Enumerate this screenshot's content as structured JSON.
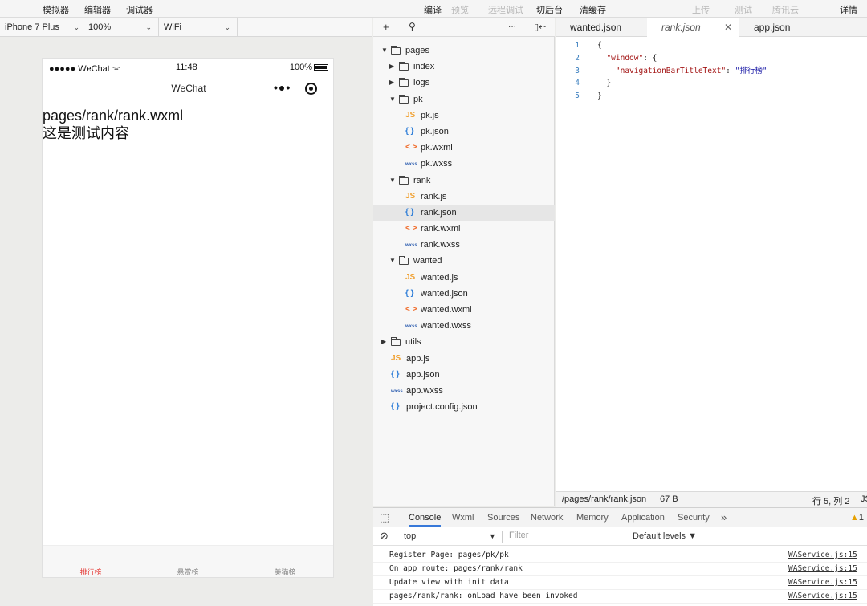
{
  "toolbar": {
    "simulator": "模拟器",
    "editor": "编辑器",
    "debugger": "调试器",
    "compile": "编译",
    "preview": "预览",
    "remote_debug": "远程调试",
    "background": "切后台",
    "clear_cache": "清缓存",
    "upload": "上传",
    "test": "测试",
    "tencent_cloud": "腾讯云",
    "details": "详情"
  },
  "sim": {
    "device": "iPhone 7 Plus",
    "zoom": "100%",
    "network": "WiFi"
  },
  "phone": {
    "carrier": "●●●●● WeChat",
    "time": "11:48",
    "battery": "100%",
    "nav_title": "WeChat",
    "content_line1": "pages/rank/rank.wxml",
    "content_line2": "这是测试内容",
    "tabs": [
      "排行榜",
      "悬赏榜",
      "美猫榜"
    ]
  },
  "tree": {
    "items": [
      {
        "label": "pages",
        "icon": "folder",
        "level": 0,
        "expanded": true
      },
      {
        "label": "index",
        "icon": "folder",
        "level": 1,
        "expanded": false
      },
      {
        "label": "logs",
        "icon": "folder",
        "level": 1,
        "expanded": false
      },
      {
        "label": "pk",
        "icon": "folder",
        "level": 1,
        "expanded": true
      },
      {
        "label": "pk.js",
        "icon": "js",
        "level": 2
      },
      {
        "label": "pk.json",
        "icon": "json",
        "level": 2
      },
      {
        "label": "pk.wxml",
        "icon": "wxml",
        "level": 2
      },
      {
        "label": "pk.wxss",
        "icon": "wxss",
        "level": 2
      },
      {
        "label": "rank",
        "icon": "folder",
        "level": 1,
        "expanded": true
      },
      {
        "label": "rank.js",
        "icon": "js",
        "level": 2
      },
      {
        "label": "rank.json",
        "icon": "json",
        "level": 2,
        "selected": true
      },
      {
        "label": "rank.wxml",
        "icon": "wxml",
        "level": 2
      },
      {
        "label": "rank.wxss",
        "icon": "wxss",
        "level": 2
      },
      {
        "label": "wanted",
        "icon": "folder",
        "level": 1,
        "expanded": true
      },
      {
        "label": "wanted.js",
        "icon": "js",
        "level": 2
      },
      {
        "label": "wanted.json",
        "icon": "json",
        "level": 2
      },
      {
        "label": "wanted.wxml",
        "icon": "wxml",
        "level": 2
      },
      {
        "label": "wanted.wxss",
        "icon": "wxss",
        "level": 2
      },
      {
        "label": "utils",
        "icon": "folder",
        "level": 0,
        "expanded": false
      },
      {
        "label": "app.js",
        "icon": "js",
        "level": 0
      },
      {
        "label": "app.json",
        "icon": "json",
        "level": 0
      },
      {
        "label": "app.wxss",
        "icon": "wxss",
        "level": 0
      },
      {
        "label": "project.config.json",
        "icon": "json",
        "level": 0
      }
    ]
  },
  "editor": {
    "tabs": [
      "wanted.json",
      "rank.json",
      "app.json"
    ],
    "active_tab": "rank.json",
    "lines": [
      "1",
      "2",
      "3",
      "4",
      "5"
    ],
    "code": {
      "l1": "{",
      "l2_key": "\"window\"",
      "l2_rest": ": {",
      "l3_key": "\"navigationBarTitleText\"",
      "l3_sep": ": ",
      "l3_val": "\"排行榜\"",
      "l4": "}",
      "l5": "}"
    },
    "status_path": "/pages/rank/rank.json",
    "status_size": "67 B",
    "status_pos": "行 5, 列 2",
    "status_lang": "JS"
  },
  "console": {
    "tabs": [
      "Console",
      "Wxml",
      "Sources",
      "Network",
      "Memory",
      "Application",
      "Security"
    ],
    "more": "»",
    "warnings": "1",
    "context": "top",
    "filter_placeholder": "Filter",
    "levels": "Default levels ▼",
    "logs": [
      {
        "text": "Register Page: pages/pk/pk",
        "src": "WAService.js:15"
      },
      {
        "text": "On app route: pages/rank/rank",
        "src": "WAService.js:15"
      },
      {
        "text": "Update view with init data",
        "src": "WAService.js:15"
      },
      {
        "text": "pages/rank/rank: onLoad have been invoked",
        "src": "WAService.js:15"
      }
    ]
  },
  "colors": {
    "accent": "#3879d9",
    "tab_active": "#e53935"
  }
}
